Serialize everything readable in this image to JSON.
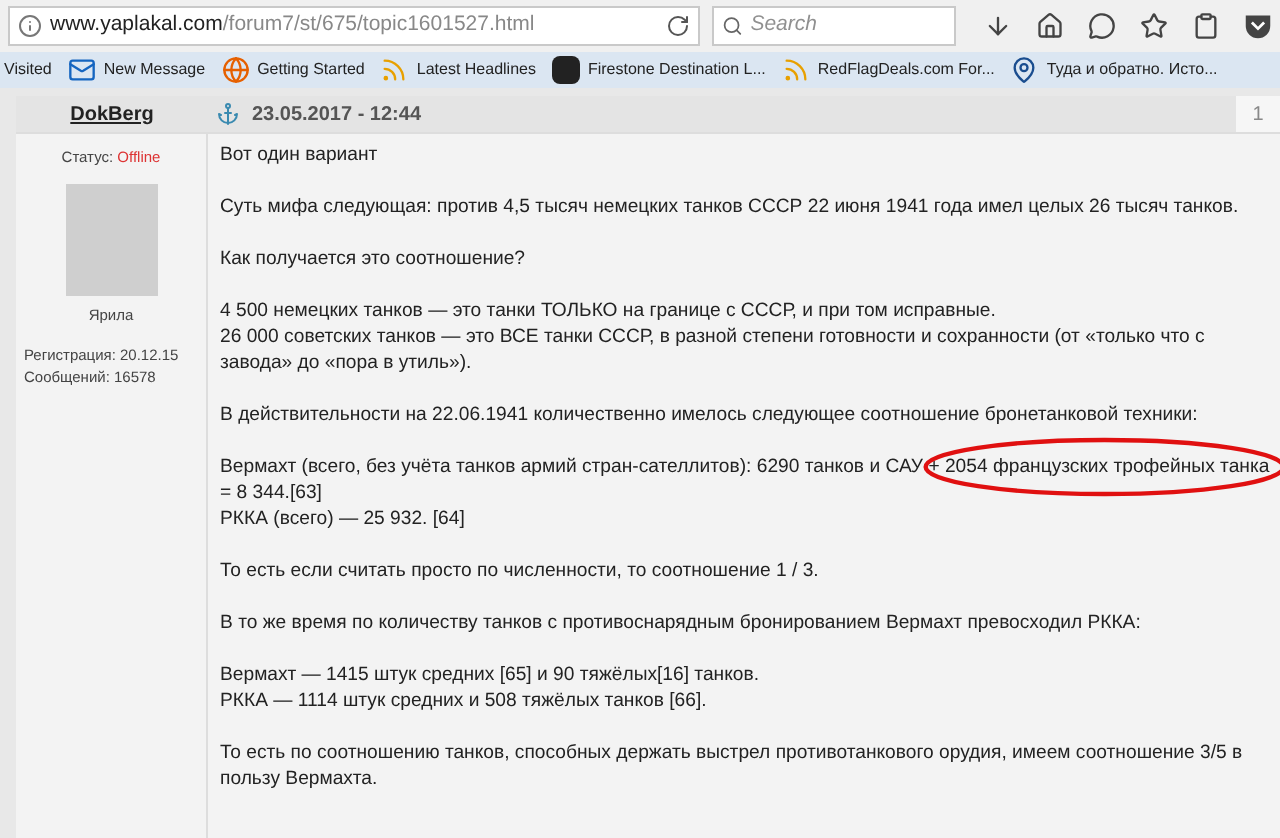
{
  "browser": {
    "url_host": "www.yaplakal.com",
    "url_path": "/forum7/st/675/topic1601527.html",
    "search": {
      "placeholder": "Search"
    }
  },
  "bookmarks": [
    {
      "label": "Visited",
      "kind": "plain"
    },
    {
      "label": "New Message",
      "kind": "mail"
    },
    {
      "label": "Getting Started",
      "kind": "globe"
    },
    {
      "label": "Latest Headlines",
      "kind": "feed"
    },
    {
      "label": "Firestone Destination L...",
      "kind": "tire"
    },
    {
      "label": "RedFlagDeals.com For...",
      "kind": "feed"
    },
    {
      "label": "Туда и обратно. Исто...",
      "kind": "pin"
    }
  ],
  "post": {
    "author": "DokBerg",
    "date": "23.05.2017 - 12:44",
    "number": "1",
    "status_label": "Статус:",
    "status": "Offline",
    "online": false,
    "rank": "Ярила",
    "registration": "Регистрация: 20.12.15",
    "messages": "Сообщений: 16578",
    "paragraphs": [
      [
        "Вот один вариант"
      ],
      [
        "Суть мифа следующая: против 4,5 тысяч немецких танков СССР 22 июня 1941 года имел целых 26 тысяч танков."
      ],
      [
        "Как получается это соотношение?"
      ],
      [
        "4 500 немецких танков — это танки ТОЛЬКО на границе с СССР, и при том исправные.",
        "26 000 советских танков — это ВСЕ танки СССР, в разной степени готовности и сохранности (от «только что с завода» до «пора в утиль»)."
      ],
      [
        "В действительности на 22.06.1941 количественно имелось следующее соотношение бронетанковой техники:"
      ],
      [
        {
          "before": "Вермахт (всего, без учёта танков армий стран-сателлитов): 6290 танков и САУ",
          "circled": "+ 2054 французских трофейных танка",
          "after": "= 8 344.[63]"
        },
        "РККА (всего) — 25 932. [64]"
      ],
      [
        "То есть если считать просто по численности, то соотношение 1 / 3."
      ],
      [
        "В то же время по количеству танков с противоснарядным бронированием Вермахт превосходил РККА:"
      ],
      [
        "Вермахт — 1415 штук средних [65] и 90 тяжёлых[16] танков.",
        "РККА — 1114 штук средних и 508 тяжёлых танков [66]."
      ],
      [
        "То есть по соотношению танков, способных держать выстрел противотанкового орудия, имеем соотношение 3/5 в пользу Вермахта."
      ]
    ]
  }
}
